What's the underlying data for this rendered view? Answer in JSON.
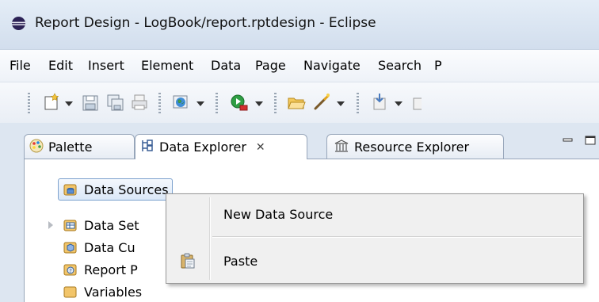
{
  "window": {
    "title": "Report Design - LogBook/report.rptdesign - Eclipse"
  },
  "menubar": {
    "items": [
      "File",
      "Edit",
      "Insert",
      "Element",
      "Data",
      "Page",
      "Navigate",
      "Search",
      "P"
    ]
  },
  "toolbar": {
    "icons": [
      "new-icon",
      "save-icon",
      "save-all-icon",
      "print-icon",
      "web-globe-icon",
      "run-icon",
      "open-folder-icon",
      "wand-icon",
      "import-icon"
    ]
  },
  "tabs": [
    {
      "label": "Palette",
      "icon": "palette-icon",
      "active": false
    },
    {
      "label": "Data Explorer",
      "icon": "data-explorer-icon",
      "active": true,
      "close": "✕"
    },
    {
      "label": "Resource Explorer",
      "icon": "library-icon",
      "active": false
    }
  ],
  "tree": {
    "items": [
      {
        "label": "Data Sources",
        "icon": "data-source-icon",
        "selected": true
      },
      {
        "label": "Data Set",
        "icon": "data-set-icon",
        "expandable": true
      },
      {
        "label": "Data Cu",
        "icon": "data-cube-icon"
      },
      {
        "label": "Report P",
        "icon": "report-params-icon"
      },
      {
        "label": "Variables",
        "icon": "variables-icon"
      }
    ]
  },
  "context_menu": {
    "items": [
      {
        "label": "New Data Source",
        "icon": ""
      },
      {
        "label": "Paste",
        "icon": "paste-icon"
      }
    ]
  },
  "colors": {
    "title_bg": "#dbe6f3",
    "selection_border": "#7da2ce",
    "menu_bg": "#f0f0f0"
  }
}
